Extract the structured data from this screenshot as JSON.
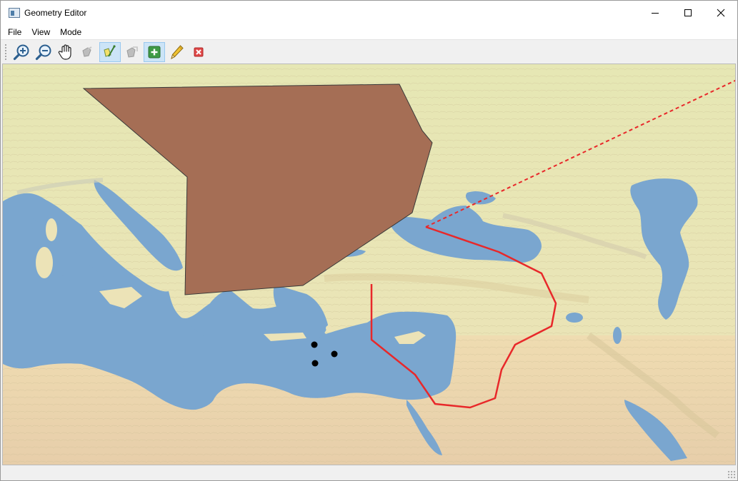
{
  "window": {
    "title": "Geometry Editor",
    "icon": "app-window-icon",
    "controls": [
      "minimize-icon",
      "maximize-icon",
      "close-icon"
    ]
  },
  "menu": {
    "items": [
      "File",
      "View",
      "Mode"
    ]
  },
  "toolbar": {
    "tools": [
      {
        "name": "zoom-in-icon",
        "state": "enabled"
      },
      {
        "name": "zoom-out-icon",
        "state": "enabled"
      },
      {
        "name": "pan-hand-icon",
        "state": "enabled"
      },
      {
        "name": "select-feature-icon",
        "state": "disabled"
      },
      {
        "name": "edit-vertices-icon",
        "state": "active"
      },
      {
        "name": "move-feature-icon",
        "state": "disabled"
      },
      {
        "name": "add-feature-icon",
        "state": "active"
      },
      {
        "name": "pencil-icon",
        "state": "enabled"
      },
      {
        "name": "delete-feature-icon",
        "state": "enabled"
      }
    ]
  },
  "map": {
    "basemap": "Mediterranean / Black Sea / Caspian shaded relief",
    "colors": {
      "sea": "#7aa6cf",
      "land": "#ece3b7",
      "polygon_fill": "#a56e55",
      "polygon_stroke": "#3a3a3a",
      "line": "#e8282a",
      "points": "#000000"
    },
    "features": {
      "polygon_count": 1,
      "polyline_count": 2,
      "point_count": 3
    }
  }
}
